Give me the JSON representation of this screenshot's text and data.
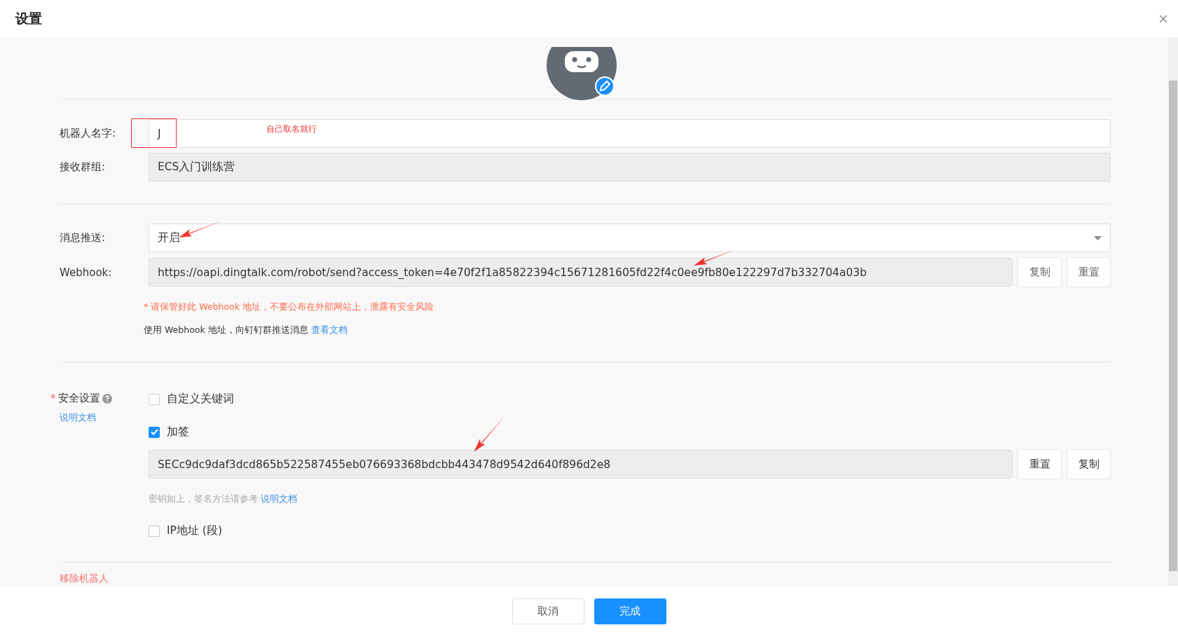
{
  "window": {
    "title": "设置",
    "close": "×"
  },
  "name_field": {
    "label": "机器人名字:",
    "value": "J",
    "note": "自己取名就行"
  },
  "group_field": {
    "label": "接收群组:",
    "value": "ECS入门训练营"
  },
  "push_field": {
    "label": "消息推送:",
    "value": "开启"
  },
  "webhook": {
    "label": "Webhook:",
    "value": "https://oapi.dingtalk.com/robot/send?access_token=4e70f2f1a85822394c15671281605fd22f4c0ee9fb80e122297d7b332704a03b",
    "buttons": [
      "复制",
      "重置"
    ],
    "warning": "* 请保管好此 Webhook 地址，不要公布在外部网站上，泄露有安全风险",
    "usage": "使用 Webhook 地址，向钉钉群推送消息",
    "usage_link": "查看文档"
  },
  "security": {
    "label": "安全设置",
    "required_mark": "*",
    "doc_link": "说明文档",
    "options": [
      {
        "kind": "plain",
        "label": "自定义关键词",
        "checked": false
      },
      {
        "kind": "secret",
        "label": "加签",
        "checked": true,
        "value": "SECc9dc9daf3dcd865b522587455eb076693368bdcbb443478d9542d640f896d2e8",
        "buttons": [
          "重置",
          "复制"
        ],
        "hint": "密钥如上，签名方法请参考",
        "hint_link": "说明文档"
      },
      {
        "kind": "plain",
        "label": "IP地址 (段)",
        "checked": false
      }
    ]
  },
  "remove_link": "移除机器人",
  "footer": {
    "buttons": [
      {
        "label": "取消",
        "kind": "default"
      },
      {
        "label": "完成",
        "kind": "primary"
      }
    ]
  }
}
